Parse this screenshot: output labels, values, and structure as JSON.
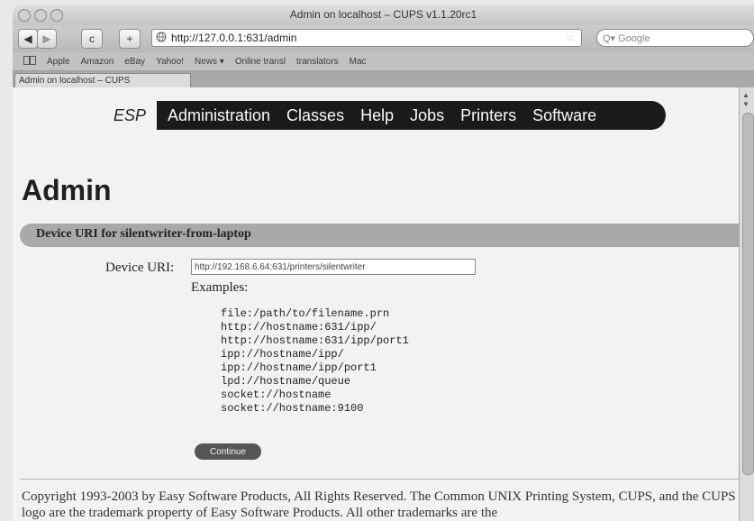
{
  "window": {
    "title": "Admin on localhost – CUPS v1.1.20rc1"
  },
  "toolbar": {
    "back_label": "◀",
    "forward_label": "▶",
    "reload_label": "c",
    "add_label": "+",
    "url": "http://127.0.0.1:631/admin",
    "search_placeholder": "Q▾ Google"
  },
  "bookmarks": {
    "items": [
      "Apple",
      "Amazon",
      "eBay",
      "Yahoo!",
      "News ▾",
      "Online transl",
      "translators",
      "Mac"
    ]
  },
  "tab": {
    "label": "Admin on localhost – CUPS"
  },
  "nav": {
    "brand": "ESP",
    "items": [
      "Administration",
      "Classes",
      "Help",
      "Jobs",
      "Printers",
      "Software"
    ]
  },
  "page": {
    "title": "Admin",
    "section_title": "Device URI for silentwriter-from-laptop",
    "uri_label": "Device URI:",
    "uri_value": "http://192.168.6.64:631/printers/silentwriter",
    "examples_label": "Examples:",
    "examples": [
      "file:/path/to/filename.prn",
      "http://hostname:631/ipp/",
      "http://hostname:631/ipp/port1",
      "ipp://hostname/ipp/",
      "ipp://hostname/ipp/port1",
      "lpd://hostname/queue",
      "socket://hostname",
      "socket://hostname:9100"
    ],
    "continue_label": "Continue",
    "footer": "Copyright 1993-2003 by Easy Software Products, All Rights Reserved. The Common UNIX Printing System, CUPS, and the CUPS logo are the trademark property of Easy Software Products. All other trademarks are the"
  },
  "colors": {
    "nav_bg": "#1a1a1a",
    "section_bar": "#a9a9a9",
    "button_bg": "#555555"
  }
}
